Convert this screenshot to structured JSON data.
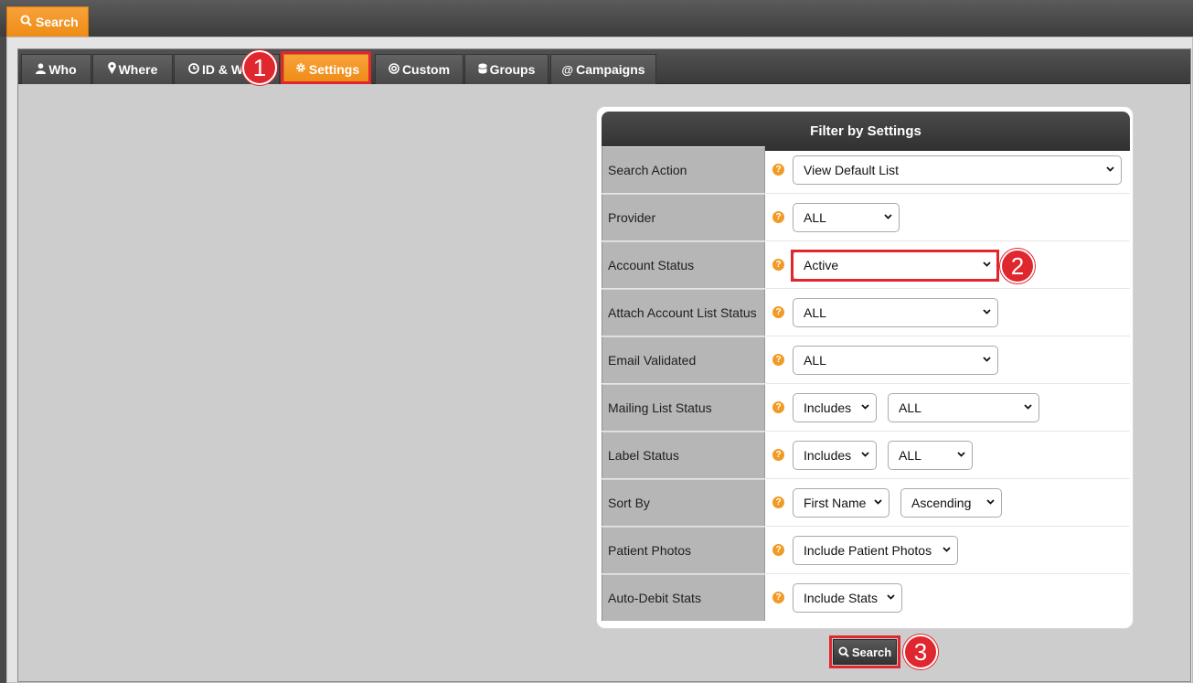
{
  "top_tab": {
    "label": "Search",
    "icon": "search-icon"
  },
  "tabs": [
    {
      "label": "Who",
      "icon": "user-icon"
    },
    {
      "label": "Where",
      "icon": "map-pin-icon"
    },
    {
      "label": "ID & W",
      "icon": "clock-icon"
    },
    {
      "label": "Settings",
      "icon": "gear-icon",
      "active": true
    },
    {
      "label": "Custom",
      "icon": "at-circle-icon"
    },
    {
      "label": "Groups",
      "icon": "group-icon"
    },
    {
      "label": "Campaigns",
      "icon": "at-icon"
    }
  ],
  "panel": {
    "title": "Filter by Settings",
    "rows": [
      {
        "label": "Search Action",
        "selects": [
          "View Default List"
        ]
      },
      {
        "label": "Provider",
        "selects": [
          "ALL"
        ]
      },
      {
        "label": "Account Status",
        "selects": [
          "Active"
        ]
      },
      {
        "label": "Attach Account List Status",
        "selects": [
          "ALL"
        ]
      },
      {
        "label": "Email Validated",
        "selects": [
          "ALL"
        ]
      },
      {
        "label": "Mailing List Status",
        "selects": [
          "Includes",
          "ALL"
        ]
      },
      {
        "label": "Label Status",
        "selects": [
          "Includes",
          "ALL"
        ]
      },
      {
        "label": "Sort By",
        "selects": [
          "First Name",
          "Ascending"
        ]
      },
      {
        "label": "Patient Photos",
        "selects": [
          "Include Patient Photos"
        ]
      },
      {
        "label": "Auto-Debit Stats",
        "selects": [
          "Include Stats"
        ]
      }
    ]
  },
  "search_button": {
    "label": "Search"
  },
  "annotations": [
    "1",
    "2",
    "3"
  ],
  "colors": {
    "accent": "#ef8c16",
    "highlight": "#e0262e",
    "dark": "#3a3a3a"
  }
}
